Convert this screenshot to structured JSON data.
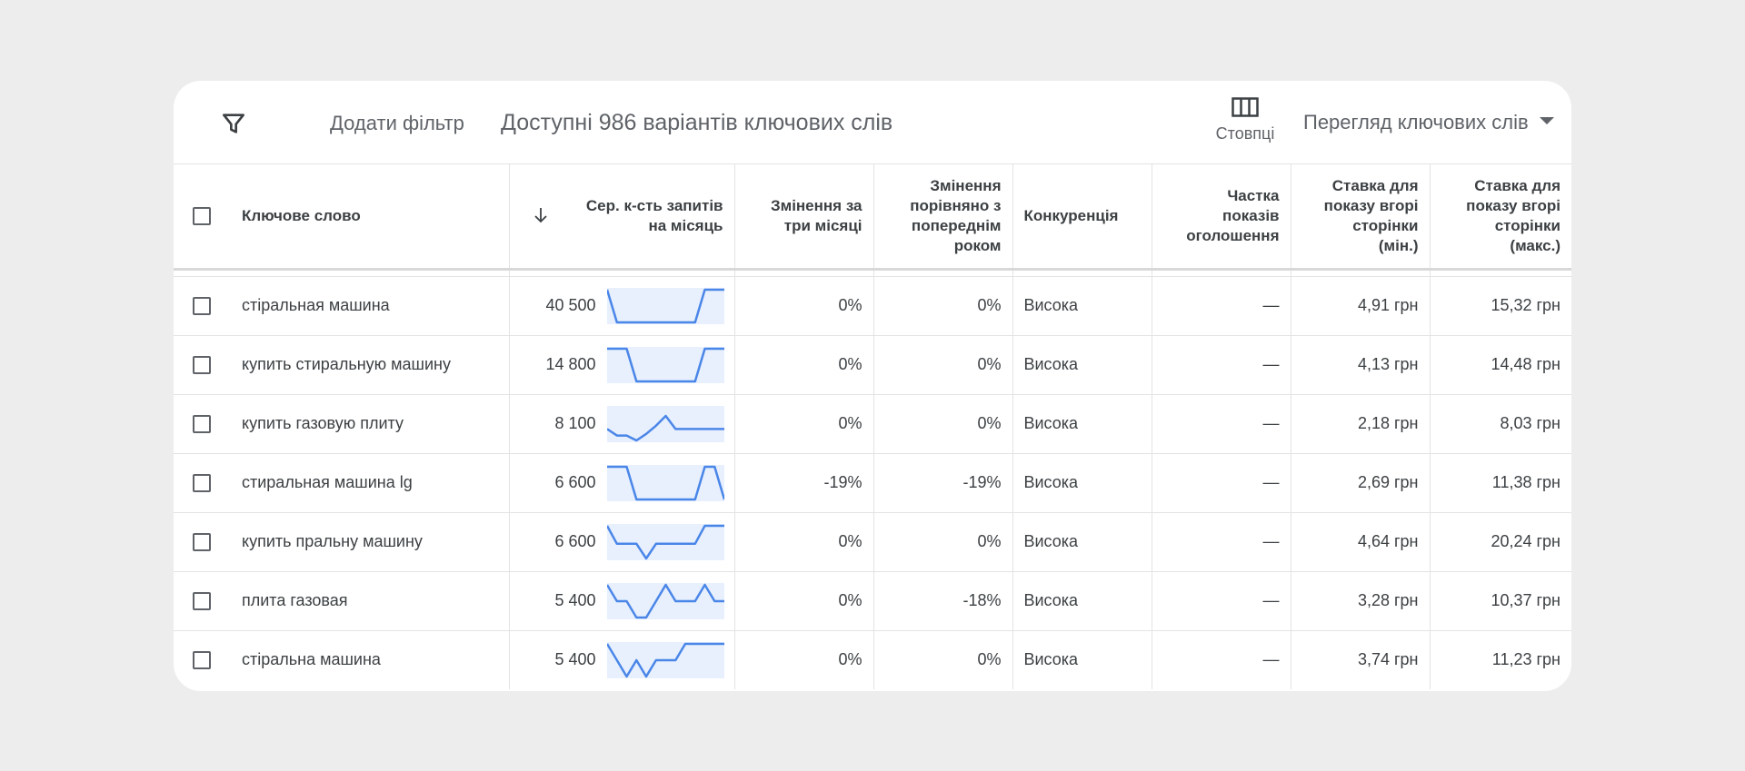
{
  "toolbar": {
    "filter_icon": "filter-icon",
    "add_filter_label": "Додати фільтр",
    "title": "Доступні 986 варіантів ключових слів",
    "columns_icon": "columns-icon",
    "columns_label": "Стовпці",
    "view_label": "Перегляд ключових слів"
  },
  "colors": {
    "accent": "#4a86e8",
    "spark_fill": "#e8f0fe",
    "text": "#3c4043",
    "muted": "#5f6368"
  },
  "table": {
    "headers": {
      "keyword": "Ключове слово",
      "volume_line1": "Сер. к-сть запитів",
      "volume_line2": "на місяць",
      "three_month_line1": "Змінення за",
      "three_month_line2": "три місяці",
      "yoy_line1": "Змінення",
      "yoy_line2": "порівняно з",
      "yoy_line3": "попереднім",
      "yoy_line4": "роком",
      "competition": "Конкуренція",
      "impr_line1": "Частка",
      "impr_line2": "показів",
      "impr_line3": "оголошення",
      "bidmin_line1": "Ставка для",
      "bidmin_line2": "показу вгорі",
      "bidmin_line3": "сторінки",
      "bidmin_line4": "(мін.)",
      "bidmax_line1": "Ставка для",
      "bidmax_line2": "показу вгорі",
      "bidmax_line3": "сторінки",
      "bidmax_line4": "(макс.)"
    },
    "rows": [
      {
        "keyword": "стіральная машина",
        "volume": "40 500",
        "trend": [
          1,
          0,
          0,
          0,
          0,
          0,
          0,
          0,
          0,
          0,
          1,
          1,
          1
        ],
        "three_month": "0%",
        "yoy": "0%",
        "competition": "Висока",
        "impression_share": "—",
        "bid_min": "4,91 грн",
        "bid_max": "15,32 грн"
      },
      {
        "keyword": "купить стиральную машину",
        "volume": "14 800",
        "trend": [
          1,
          1,
          1,
          0,
          0,
          0,
          0,
          0,
          0,
          0,
          1,
          1,
          1
        ],
        "three_month": "0%",
        "yoy": "0%",
        "competition": "Висока",
        "impression_share": "—",
        "bid_min": "4,13 грн",
        "bid_max": "14,48 грн"
      },
      {
        "keyword": "купить газовую плиту",
        "volume": "8 100",
        "trend": [
          0.35,
          0.15,
          0.15,
          0,
          0.2,
          0.45,
          0.75,
          0.35,
          0.35,
          0.35,
          0.35,
          0.35,
          0.35
        ],
        "three_month": "0%",
        "yoy": "0%",
        "competition": "Висока",
        "impression_share": "—",
        "bid_min": "2,18 грн",
        "bid_max": "8,03 грн"
      },
      {
        "keyword": "стиральная машина lg",
        "volume": "6 600",
        "trend": [
          1,
          1,
          1,
          0,
          0,
          0,
          0,
          0,
          0,
          0,
          1,
          1,
          0
        ],
        "three_month": "-19%",
        "yoy": "-19%",
        "competition": "Висока",
        "impression_share": "—",
        "bid_min": "2,69 грн",
        "bid_max": "11,38 грн"
      },
      {
        "keyword": "купить пральну машину",
        "volume": "6 600",
        "trend": [
          1,
          0.45,
          0.45,
          0.45,
          0,
          0.45,
          0.45,
          0.45,
          0.45,
          0.45,
          1,
          1,
          1
        ],
        "three_month": "0%",
        "yoy": "0%",
        "competition": "Висока",
        "impression_share": "—",
        "bid_min": "4,64 грн",
        "bid_max": "20,24 грн"
      },
      {
        "keyword": "плита газовая",
        "volume": "5 400",
        "trend": [
          1,
          0.5,
          0.5,
          0,
          0,
          0.5,
          1,
          0.5,
          0.5,
          0.5,
          1,
          0.5,
          0.5
        ],
        "three_month": "0%",
        "yoy": "-18%",
        "competition": "Висока",
        "impression_share": "—",
        "bid_min": "3,28 грн",
        "bid_max": "10,37 грн"
      },
      {
        "keyword": "стіральна машина",
        "volume": "5 400",
        "trend": [
          1,
          0.5,
          0,
          0.5,
          0,
          0.5,
          0.5,
          0.5,
          1,
          1,
          1,
          1,
          1
        ],
        "three_month": "0%",
        "yoy": "0%",
        "competition": "Висока",
        "impression_share": "—",
        "bid_min": "3,74 грн",
        "bid_max": "11,23 грн"
      }
    ]
  }
}
